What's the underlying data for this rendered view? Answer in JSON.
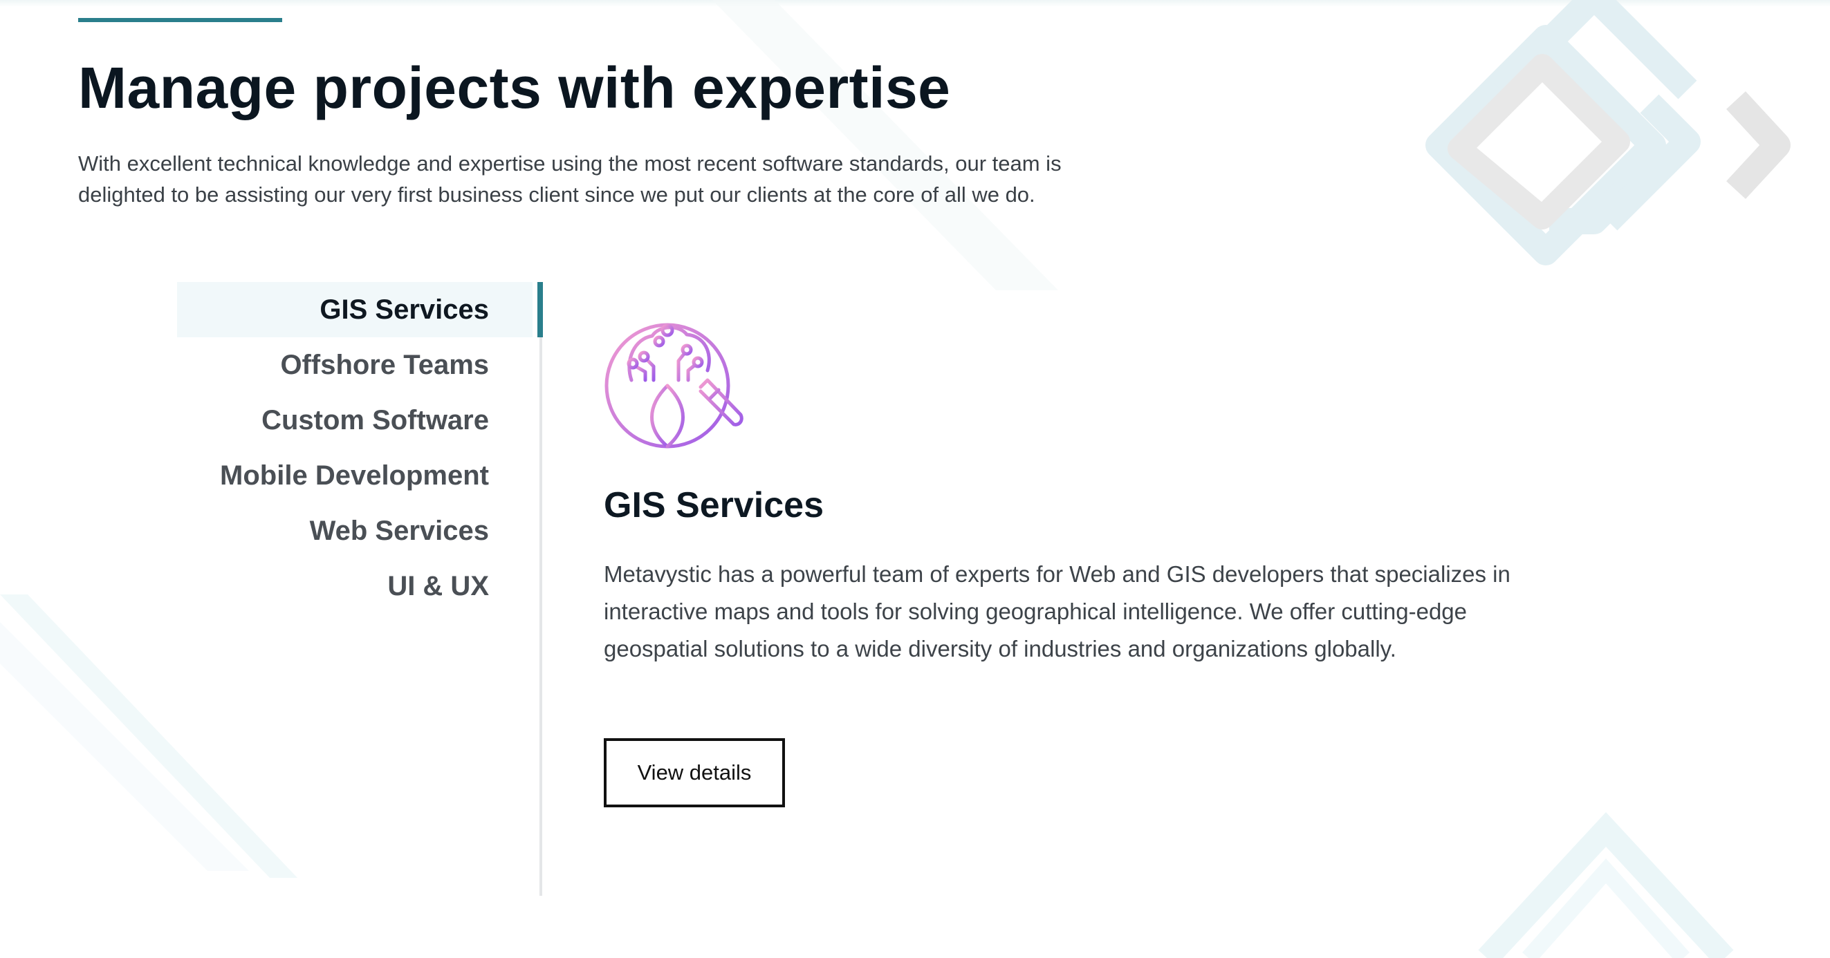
{
  "header": {
    "title": "Manage projects with expertise",
    "intro": "With excellent technical knowledge and expertise using the most recent software standards, our team is delighted to be assisting our very first business client since we put our clients at the core of all we do."
  },
  "services_nav": {
    "items": [
      {
        "label": "GIS Services",
        "active": true
      },
      {
        "label": "Offshore Teams",
        "active": false
      },
      {
        "label": "Custom Software",
        "active": false
      },
      {
        "label": "Mobile Development",
        "active": false
      },
      {
        "label": "Web Services",
        "active": false
      },
      {
        "label": "UI & UX",
        "active": false
      }
    ]
  },
  "detail": {
    "icon": "globe-circuit-magnifier-icon",
    "title": "GIS Services",
    "description": "Metavystic has a powerful team of experts for Web and GIS developers that specializes in interactive maps and tools for solving geographical intelligence. We offer cutting-edge geospatial solutions to a wide diversity of industries and organizations globally.",
    "button_label": "View details"
  },
  "colors": {
    "accent": "#2a7f8c",
    "heading": "#0b1620",
    "body_text": "#3d4349",
    "nav_active_bg": "#f1f8fa",
    "icon_gradient_start": "#f29bd0",
    "icon_gradient_end": "#9d5ce8"
  }
}
